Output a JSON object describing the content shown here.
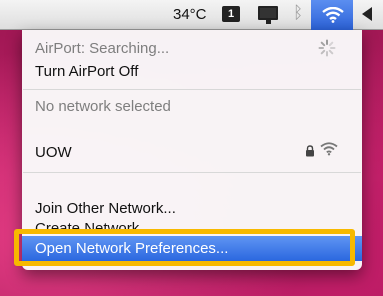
{
  "menubar": {
    "temperature": "34°C",
    "calendar_day": "1"
  },
  "menu": {
    "status": "AirPort: Searching...",
    "toggle_airport": "Turn AirPort Off",
    "no_network": "No network selected",
    "networks": [
      {
        "name": "UOW",
        "secured": true
      }
    ],
    "join_other": "Join Other Network...",
    "create_network": "Create Network...",
    "open_preferences": "Open Network Preferences..."
  },
  "colors": {
    "highlight": "#2b67df",
    "callout": "#f7b900"
  },
  "icons": [
    "calendar-icon",
    "display-icon",
    "bluetooth-icon",
    "wifi-icon",
    "volume-icon",
    "spinner-icon",
    "lock-icon"
  ]
}
